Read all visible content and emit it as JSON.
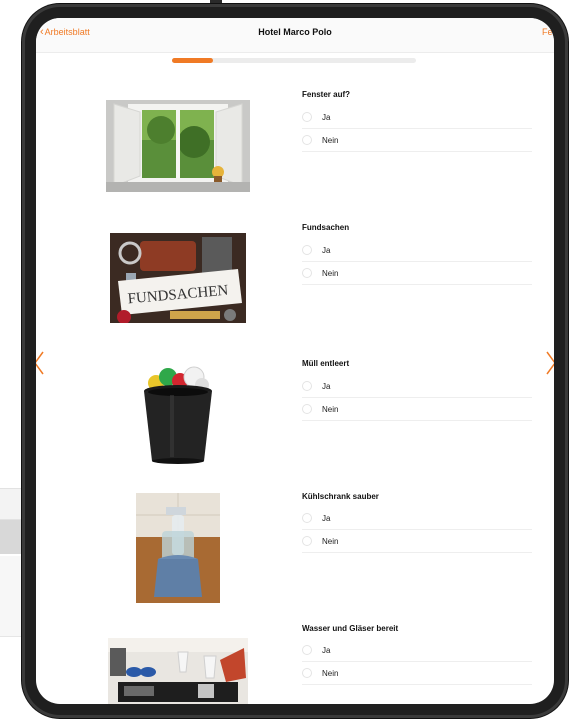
{
  "nav": {
    "back_label": "Arbeitsblatt",
    "title": "Hotel Marco Polo",
    "done_label": "Fert"
  },
  "progress": {
    "fraction": 0.17
  },
  "colors": {
    "accent": "#f07a25"
  },
  "questions": [
    {
      "title": "Fenster auf?",
      "options": [
        "Ja",
        "Nein"
      ],
      "image": "open-window-photo"
    },
    {
      "title": "Fundsachen",
      "options": [
        "Ja",
        "Nein"
      ],
      "image": "lost-and-found-photo"
    },
    {
      "title": "Müll entleert",
      "options": [
        "Ja",
        "Nein"
      ],
      "image": "trash-bin-photo"
    },
    {
      "title": "Kühlschrank sauber",
      "options": [
        "Ja",
        "Nein"
      ],
      "image": "cleaning-spray-photo"
    },
    {
      "title": "Wasser und Gläser bereit",
      "options": [
        "Ja",
        "Nein"
      ],
      "image": "glasses-tray-photo"
    }
  ],
  "photo_labels": {
    "fundsachen_sign": "FUNDSACHEN"
  }
}
